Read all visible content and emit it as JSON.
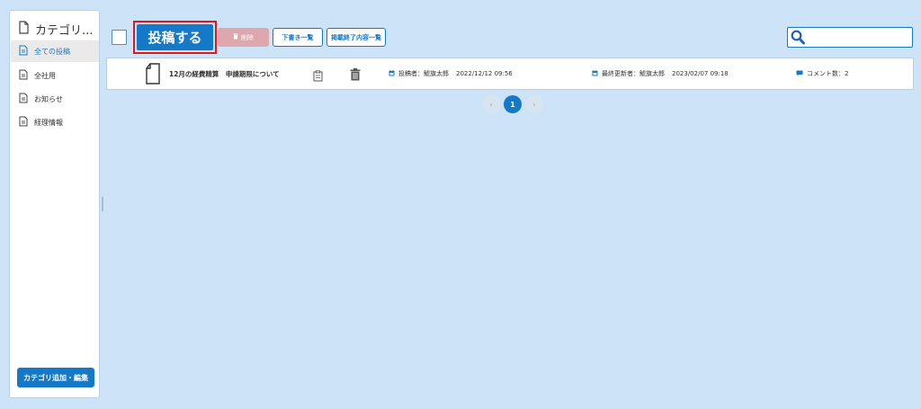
{
  "sidebar": {
    "title": "カテゴリ...",
    "items": [
      {
        "label": "全ての投稿",
        "active": true
      },
      {
        "label": "全社用",
        "active": false
      },
      {
        "label": "お知らせ",
        "active": false
      },
      {
        "label": "経理情報",
        "active": false
      }
    ],
    "add_edit_button": "カテゴリ追加・編集"
  },
  "toolbar": {
    "post_button": "投稿する",
    "delete_button": "削除",
    "drafts_button": "下書き一覧",
    "expired_button": "掲載終了内容一覧",
    "search_placeholder": ""
  },
  "posts": [
    {
      "title": "12月の経費精算　申請期限について",
      "author_label": "投稿者：鯱旗太郎",
      "posted_at": "2022/12/12 09:56",
      "updater_label": "最終更新者：鯱旗太郎",
      "updated_at": "2023/02/07 09:18",
      "comments": "コメント数：2"
    }
  ],
  "pagination": {
    "prev": "‹",
    "current": "1",
    "next": "›"
  },
  "colors": {
    "accent": "#1579c8",
    "background": "#cde3f7",
    "delete_disabled": "#dea7ae",
    "highlight_frame": "#e3141b"
  }
}
